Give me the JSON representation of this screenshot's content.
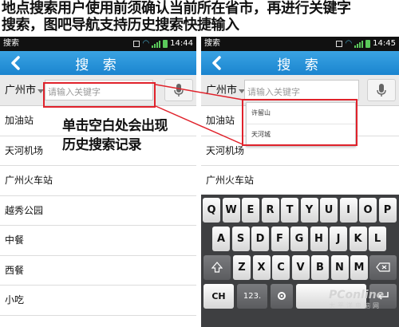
{
  "caption": {
    "line1": "地点搜索用户使用前须确认当前所在省市，再进行关键字",
    "line2": "搜索，图吧导航支持历史搜索快捷输入"
  },
  "annotation": {
    "line1": "单击空白处会出现",
    "line2": "历史搜索记录"
  },
  "accent_color": "#1a84cf",
  "highlight_color": "#e0222b",
  "left_phone": {
    "status": {
      "title": "搜索",
      "time": "14:44"
    },
    "title": "搜  索",
    "search": {
      "city": "广州市",
      "placeholder": "请输入关键字"
    },
    "list": [
      "加油站",
      "天河机场",
      "广州火车站",
      "越秀公园",
      "中餐",
      "西餐",
      "小吃"
    ]
  },
  "right_phone": {
    "status": {
      "title": "搜索",
      "time": "14:45"
    },
    "title": "搜  索",
    "search": {
      "city": "广州市",
      "placeholder": "请输入关键字"
    },
    "history": [
      "许留山",
      "天河城"
    ],
    "list": [
      "加油站",
      "天河机场",
      "广州火车站"
    ],
    "keyboard": {
      "row1": [
        "Q",
        "W",
        "E",
        "R",
        "T",
        "Y",
        "U",
        "I",
        "O",
        "P"
      ],
      "row2": [
        "A",
        "S",
        "D",
        "F",
        "G",
        "H",
        "J",
        "K",
        "L"
      ],
      "row3": [
        "Z",
        "X",
        "C",
        "V",
        "B",
        "N",
        "M"
      ],
      "ch_key": "CH",
      "num_key": "123.",
      "icons": [
        "shift-icon",
        "backspace-icon",
        "settings-icon",
        "enter-icon"
      ]
    }
  },
  "watermark": {
    "brand": "PConline",
    "sub": "太平洋电脑网"
  }
}
